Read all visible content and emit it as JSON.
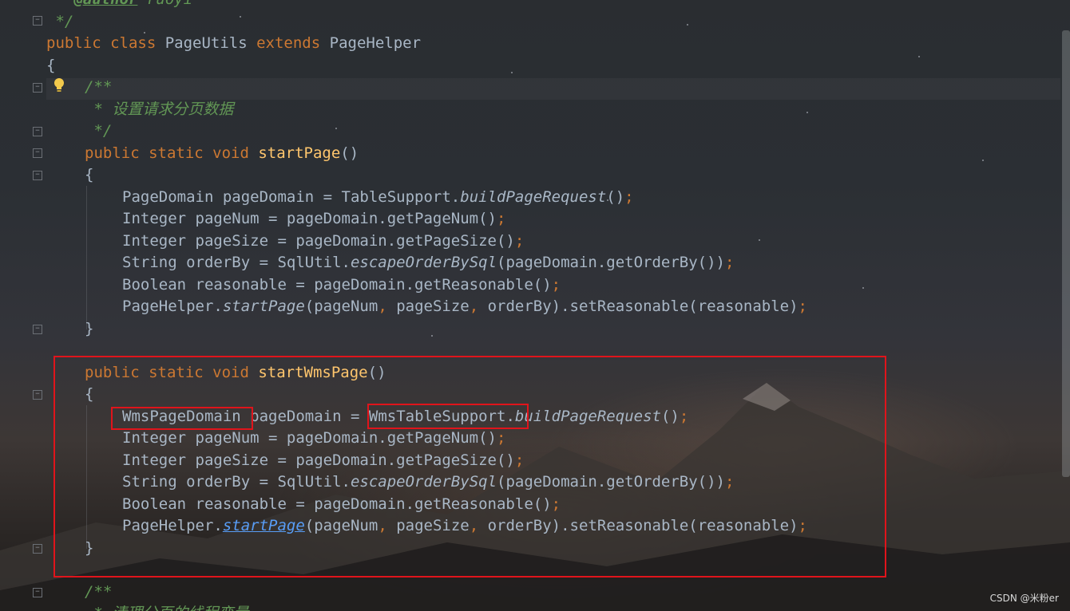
{
  "editor": {
    "colors": {
      "keyword": "#cc7832",
      "method": "#ffc66d",
      "comment": "#629755",
      "text": "#a9b7c6",
      "link": "#589df6",
      "highlight_box": "#e0141b"
    },
    "lines": {
      "l0": {
        "comment_prefix": " * ",
        "author_tag": "@author",
        "author_name": " ruoyi"
      },
      "l1": {
        "comment": " */"
      },
      "l2": {
        "kw1": "public class ",
        "name": "PageUtils ",
        "kw2": "extends ",
        "parent": "PageHelper"
      },
      "l3": {
        "brace": "{"
      },
      "l4": {
        "comment": "/**"
      },
      "l5": {
        "comment": " * 设置请求分页数据"
      },
      "l6": {
        "comment": " */"
      },
      "l7": {
        "kw": "public static void ",
        "method": "startPage",
        "rest": "()"
      },
      "l8": {
        "brace": "{"
      },
      "l9": {
        "a": "PageDomain pageDomain = TableSupport.",
        "b": "buildPageRequest",
        "c": "()",
        "d": ";"
      },
      "l10": {
        "a": "Integer pageNum = pageDomain.getPageNum()",
        "d": ";"
      },
      "l11": {
        "a": "Integer pageSize = pageDomain.getPageSize()",
        "d": ";"
      },
      "l12": {
        "a": "String orderBy = SqlUtil.",
        "b": "escapeOrderBySql",
        "c": "(pageDomain.getOrderBy())",
        "d": ";"
      },
      "l13": {
        "a": "Boolean reasonable = pageDomain.getReasonable()",
        "d": ";"
      },
      "l14": {
        "a": "PageHelper.",
        "b": "startPage",
        "c1": "(pageNum",
        "s1": ", ",
        "c2": "pageSize",
        "s2": ", ",
        "c3": "orderBy).setReasonable(reasonable)",
        "d": ";"
      },
      "l15": {
        "brace": "}"
      },
      "l16": {
        "kw": "public static void ",
        "method": "startWmsPage",
        "rest": "()"
      },
      "l17": {
        "brace": "{"
      },
      "l18": {
        "a": "WmsPageDomain",
        "a2": " pageDomain = ",
        "a3": "WmsTableSupport",
        "a4": ".",
        "b": "buildPageRequest",
        "c": "()",
        "d": ";"
      },
      "l19": {
        "a": "Integer pageNum = pageDomain.getPageNum()",
        "d": ";"
      },
      "l20": {
        "a": "Integer pageSize = pageDomain.getPageSize()",
        "d": ";"
      },
      "l21": {
        "a": "String orderBy = SqlUtil.",
        "b": "escapeOrderBySql",
        "c": "(pageDomain.getOrderBy())",
        "d": ";"
      },
      "l22": {
        "a": "Boolean reasonable = pageDomain.getReasonable()",
        "d": ";"
      },
      "l23": {
        "a": "PageHelper.",
        "b": "startPage",
        "c1": "(pageNum",
        "s1": ", ",
        "c2": "pageSize",
        "s2": ", ",
        "c3": "orderBy).setReasonable(reasonable)",
        "d": ";"
      },
      "l24": {
        "brace": "}"
      },
      "l25": {
        "comment": "/**"
      },
      "l26": {
        "comment": " * 清理分页的线程变量"
      }
    }
  },
  "watermark": "CSDN @米粉er"
}
